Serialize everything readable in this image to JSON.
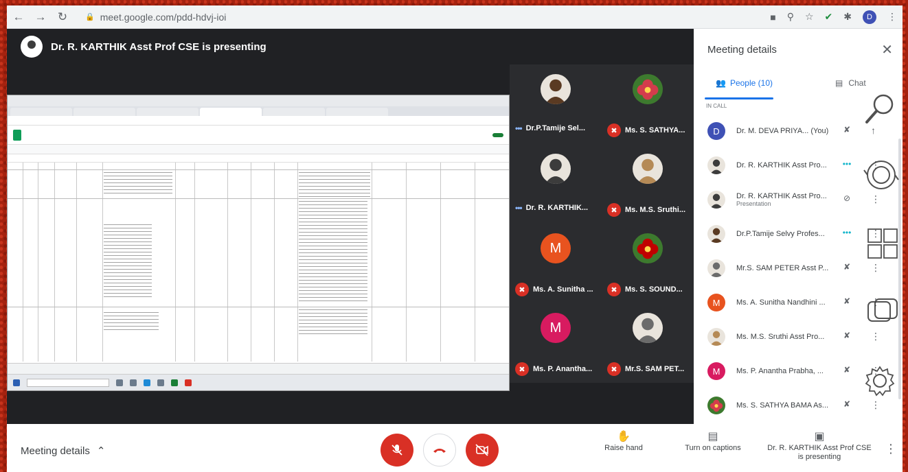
{
  "browser": {
    "url": "meet.google.com/pdd-hdvj-ioi",
    "profile_initial": "D",
    "icons": [
      "back-icon",
      "forward-icon",
      "reload-icon",
      "lock-icon",
      "camera-icon",
      "zoom-icon",
      "star-icon",
      "check-icon",
      "puzzle-icon",
      "menu-icon"
    ]
  },
  "presenter": {
    "title": "Dr. R. KARTHIK Asst Prof CSE is presenting"
  },
  "tiles": [
    {
      "name": "Dr.P.Tamije Sel...",
      "avatar": "photo",
      "avatar_color": "#5a3a22",
      "status": "speaking"
    },
    {
      "name": "Ms. S. SATHYA...",
      "avatar": "flower",
      "avatar_color": "#d33c4c",
      "status": "muted"
    },
    {
      "name": "Dr. R. KARTHIK...",
      "avatar": "photo",
      "avatar_color": "#3c3c3c",
      "status": "speaking"
    },
    {
      "name": "Ms. M.S. Sruthi...",
      "avatar": "photo",
      "avatar_color": "#b58a56",
      "status": "muted"
    },
    {
      "name": "Ms. A. Sunitha ...",
      "avatar": "M",
      "avatar_color": "#e8531f",
      "status": "muted"
    },
    {
      "name": "Ms. S. SOUND...",
      "avatar": "flower",
      "avatar_color": "#c00000",
      "status": "muted"
    },
    {
      "name": "Ms. P. Anantha...",
      "avatar": "M",
      "avatar_color": "#d81b60",
      "status": "muted"
    },
    {
      "name": "Mr.S. SAM PET...",
      "avatar": "photo",
      "avatar_color": "#6b6b6b",
      "status": "muted"
    }
  ],
  "panel": {
    "title": "Meeting details",
    "tab_people": "People (10)",
    "tab_chat": "Chat",
    "in_call": "IN CALL",
    "people": [
      {
        "name": "Dr. M. DEVA PRIYA... (You)",
        "sub": "",
        "avatar": "D",
        "avatar_color": "#3f51b5",
        "status": "muted",
        "action": "pin"
      },
      {
        "name": "Dr. R. KARTHIK Asst Pro...",
        "sub": "",
        "avatar": "photo",
        "avatar_color": "#3c3c3c",
        "status": "speaking",
        "action": "more"
      },
      {
        "name": "Dr. R. KARTHIK Asst Pro...",
        "sub": "Presentation",
        "avatar": "photo",
        "avatar_color": "#3c3c3c",
        "status": "present",
        "action": "more"
      },
      {
        "name": "Dr.P.Tamije Selvy Profes...",
        "sub": "",
        "avatar": "photo",
        "avatar_color": "#5a3a22",
        "status": "speaking-teal",
        "action": "more"
      },
      {
        "name": "Mr.S. SAM PETER Asst P...",
        "sub": "",
        "avatar": "photo",
        "avatar_color": "#6b6b6b",
        "status": "muted",
        "action": "more"
      },
      {
        "name": "Ms. A. Sunitha Nandhini ...",
        "sub": "",
        "avatar": "M",
        "avatar_color": "#e8531f",
        "status": "muted",
        "action": "more"
      },
      {
        "name": "Ms. M.S. Sruthi Asst Pro...",
        "sub": "",
        "avatar": "photo",
        "avatar_color": "#b58a56",
        "status": "muted",
        "action": "more"
      },
      {
        "name": "Ms. P. Anantha Prabha, ...",
        "sub": "",
        "avatar": "M",
        "avatar_color": "#d81b60",
        "status": "muted",
        "action": "more"
      },
      {
        "name": "Ms. S. SATHYA BAMA As...",
        "sub": "",
        "avatar": "flower",
        "avatar_color": "#d33c4c",
        "status": "muted",
        "action": "more"
      }
    ]
  },
  "bottom": {
    "meeting_details": "Meeting details",
    "raise_hand": "Raise hand",
    "captions": "Turn on captions",
    "presenting": "Dr. R. KARTHIK Asst Prof CSE is presenting"
  },
  "colors": {
    "accent": "#1a73e8",
    "danger": "#d93025",
    "stage_bg": "#202124"
  }
}
